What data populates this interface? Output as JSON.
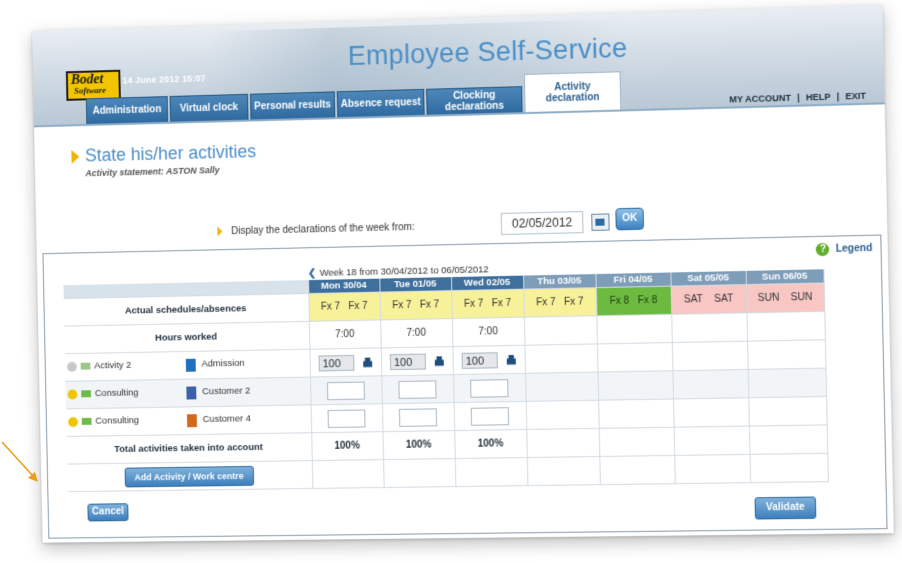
{
  "header": {
    "logo": {
      "line1": "Bodet",
      "line2": "Software"
    },
    "datetime": "14 June 2012 15:07",
    "app_title": "Employee Self-Service",
    "tabs": [
      {
        "label": "Administration",
        "active": false
      },
      {
        "label": "Virtual clock",
        "active": false
      },
      {
        "label": "Personal results",
        "active": false
      },
      {
        "label": "Absence request",
        "active": false
      },
      {
        "label": "Clocking declarations",
        "active": false
      },
      {
        "label": "Activity declaration",
        "active": true
      }
    ],
    "links": [
      "MY ACCOUNT",
      "HELP",
      "EXIT"
    ]
  },
  "page": {
    "title": "State his/her activities",
    "subtitle": "Activity statement: ASTON Sally",
    "display_label": "Display the declarations of the week from:",
    "date_value": "02/05/2012",
    "ok_label": "OK",
    "legend_label": "Legend"
  },
  "grid": {
    "week_label": "Week 18 from 30/04/2012 to 06/05/2012",
    "days": [
      "Mon 30/04",
      "Tue 01/05",
      "Wed 02/05",
      "Thu 03/05",
      "Fri 04/05",
      "Sat 05/05",
      "Sun 06/05"
    ],
    "schedules_label": "Actual schedules/absences",
    "schedules": [
      [
        "Fx 7",
        "Fx 7"
      ],
      [
        "Fx 7",
        "Fx 7"
      ],
      [
        "Fx 7",
        "Fx 7"
      ],
      [
        "Fx 7",
        "Fx 7"
      ],
      [
        "Fx 8",
        "Fx 8"
      ],
      [
        "SAT",
        "SAT"
      ],
      [
        "SUN",
        "SUN"
      ]
    ],
    "hours_label": "Hours worked",
    "hours": [
      "7:00",
      "7:00",
      "7:00",
      "",
      "",
      "",
      ""
    ],
    "rows": [
      {
        "activity": "Activity 2",
        "customer": "Admission",
        "values": [
          "100",
          "100",
          "100"
        ],
        "colors": {
          "icon": "#c8c8c8",
          "flag": "#9bc88a",
          "square": "#1f6fc0"
        }
      },
      {
        "activity": "Consulting",
        "customer": "Customer 2",
        "values": [
          "",
          "",
          ""
        ],
        "colors": {
          "icon": "#f0c400",
          "flag": "#6dbb4a",
          "square": "#3b5fa8"
        }
      },
      {
        "activity": "Consulting",
        "customer": "Customer 4",
        "values": [
          "",
          "",
          ""
        ],
        "colors": {
          "icon": "#f0c400",
          "flag": "#6dbb4a",
          "square": "#d2691e"
        }
      }
    ],
    "total_label": "Total activities taken into account",
    "totals": [
      "100%",
      "100%",
      "100%",
      "",
      "",
      "",
      ""
    ],
    "add_button": "Add Activity / Work centre"
  },
  "footer": {
    "cancel": "Cancel",
    "validate": "Validate"
  },
  "colors": {
    "accent": "#2f6aa0",
    "title_blue": "#4b8fc7",
    "arrow": "#e8a020"
  }
}
